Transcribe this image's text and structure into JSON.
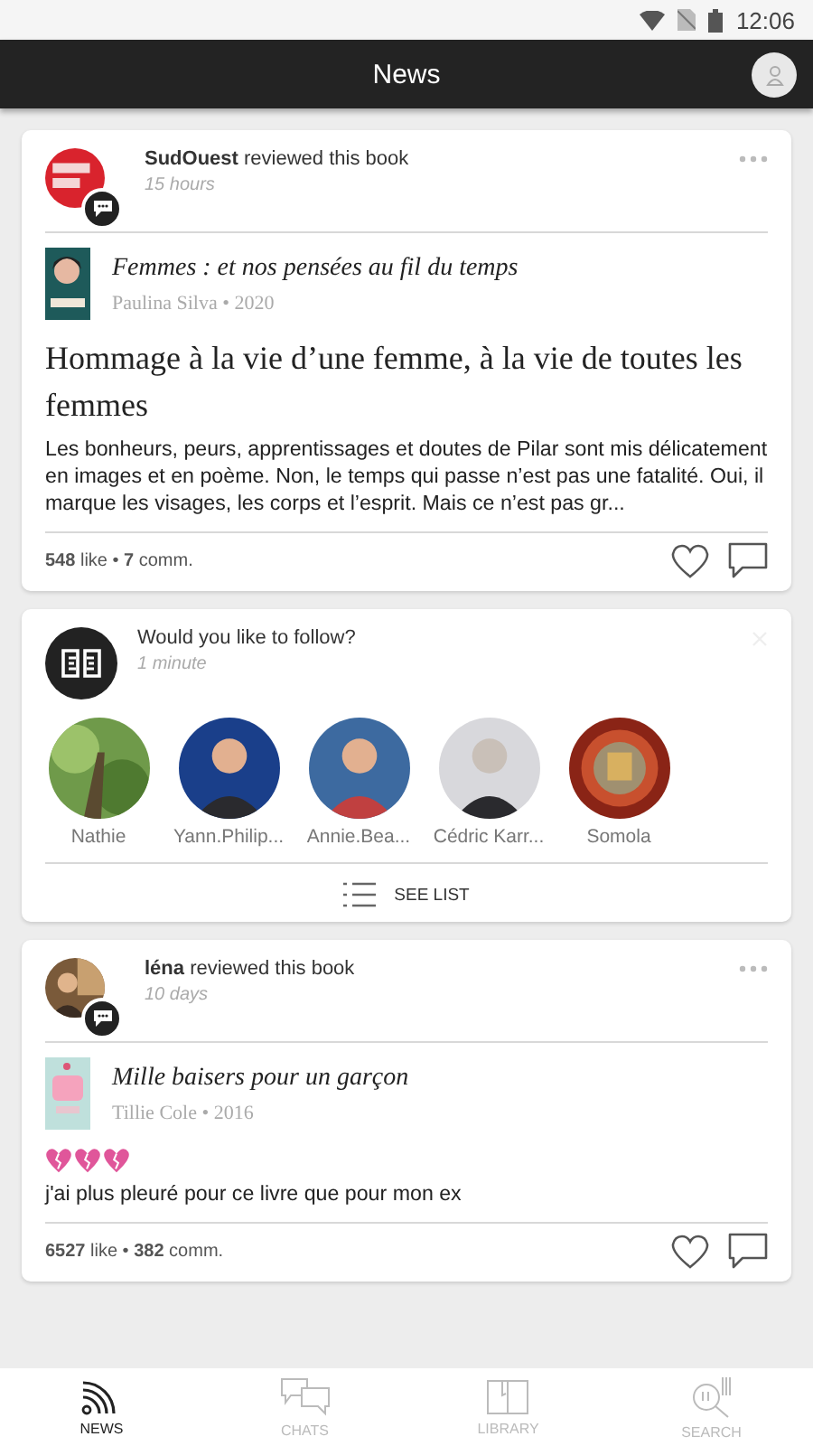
{
  "status_bar": {
    "time": "12:06"
  },
  "header": {
    "title": "News"
  },
  "feed": [
    {
      "kind": "review",
      "user": "SudOuest",
      "action": "reviewed this book",
      "time": "15 hours",
      "book": {
        "title": "Femmes : et nos pensées au fil du temps",
        "byline": "Paulina Silva • 2020"
      },
      "headline": "Hommage à la vie d’une femme, à la vie de toutes les femmes",
      "body": "Les bonheurs, peurs, apprentissages et doutes de Pilar sont mis délicatement en images et en poème. Non, le temps qui passe n’est pas une fatalité. Oui, il marque les visages, les corps et l’esprit. Mais ce n’est pas gr...",
      "stats": "**548** like • **7** comm."
    },
    {
      "kind": "suggestions",
      "title": "Would you like to follow?",
      "time": "1 minute",
      "people": [
        {
          "name": "Nathie"
        },
        {
          "name": "Yann.Philip..."
        },
        {
          "name": "Annie.Bea..."
        },
        {
          "name": "Cédric Karr..."
        },
        {
          "name": "Somola"
        }
      ],
      "action": "SEE LIST"
    },
    {
      "kind": "review",
      "user": "léna",
      "action": "reviewed this book",
      "time": "10 days",
      "book": {
        "title": "Mille baisers pour un garçon",
        "byline": "Tillie Cole • 2016"
      },
      "body": "j'ai plus pleuré pour ce livre que pour mon ex",
      "stats": "**6527** like • **382** comm."
    }
  ],
  "nav": [
    {
      "label": "NEWS",
      "selected": true
    },
    {
      "label": "CHATS",
      "selected": false
    },
    {
      "label": "LIBRARY",
      "selected": false
    },
    {
      "label": "SEARCH",
      "selected": false
    }
  ]
}
